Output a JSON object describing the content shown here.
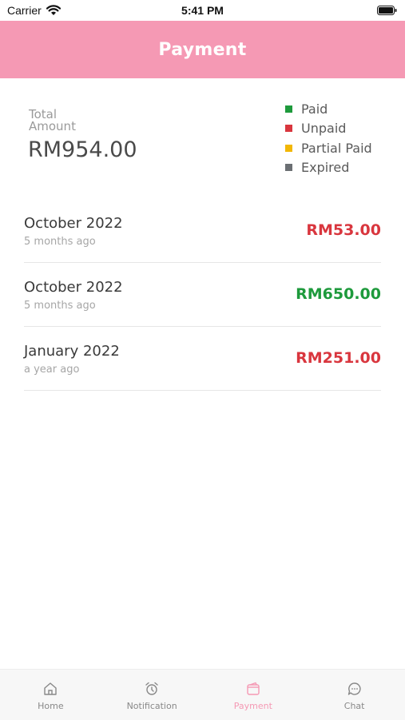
{
  "status_bar": {
    "carrier": "Carrier",
    "time": "5:41 PM"
  },
  "header": {
    "title": "Payment"
  },
  "summary": {
    "total_label": "Total Amount",
    "total_value": "RM954.00"
  },
  "legend": [
    {
      "label": "Paid",
      "color": "#1e9a3c"
    },
    {
      "label": "Unpaid",
      "color": "#d9363e"
    },
    {
      "label": "Partial Paid",
      "color": "#f2b705"
    },
    {
      "label": "Expired",
      "color": "#6b6f73"
    }
  ],
  "payments": [
    {
      "month": "October 2022",
      "ago": "5 months ago",
      "amount": "RM53.00",
      "color": "#d9363e"
    },
    {
      "month": "October 2022",
      "ago": "5 months ago",
      "amount": "RM650.00",
      "color": "#1e9a3c"
    },
    {
      "month": "January 2022",
      "ago": "a year ago",
      "amount": "RM251.00",
      "color": "#d9363e"
    }
  ],
  "tabbar": {
    "tabs": [
      {
        "label": "Home",
        "icon": "home-icon"
      },
      {
        "label": "Notification",
        "icon": "alarm-icon"
      },
      {
        "label": "Payment",
        "icon": "wallet-icon"
      },
      {
        "label": "Chat",
        "icon": "chat-icon"
      }
    ],
    "active_color": "#f599b4"
  }
}
